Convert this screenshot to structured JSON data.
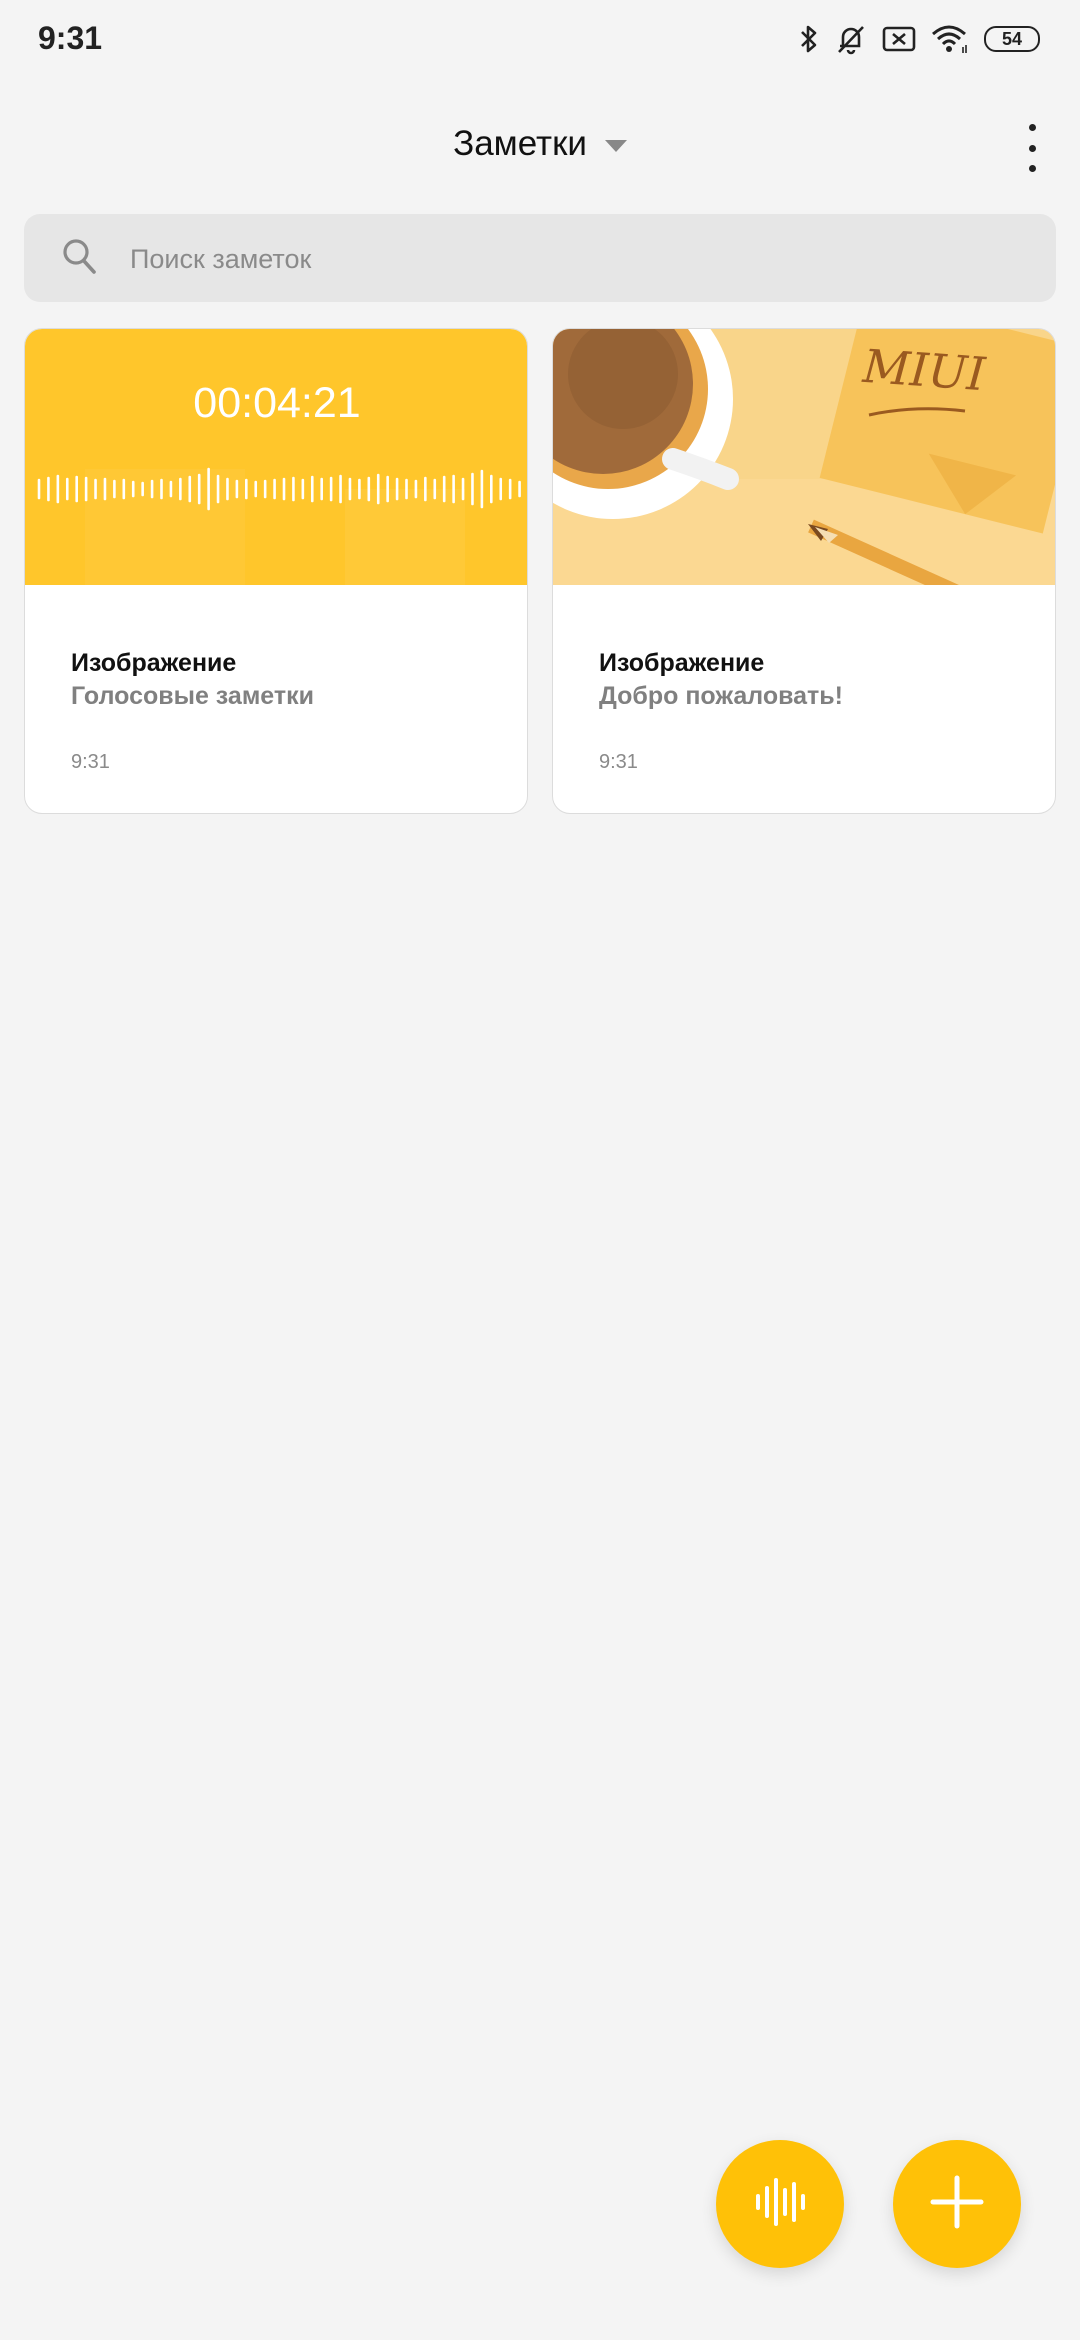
{
  "status_bar": {
    "time": "9:31",
    "battery": "54",
    "icons": [
      "bluetooth-icon",
      "muted-bell-icon",
      "no-sim-icon",
      "wifi-icon",
      "battery-icon"
    ]
  },
  "header": {
    "title": "Заметки",
    "dropdown_icon": "caret-down-icon",
    "more_icon": "more-vertical-icon"
  },
  "search": {
    "placeholder": "Поиск заметок",
    "value": "",
    "icon": "search-icon"
  },
  "notes": [
    {
      "thumbnail": "voice-waveform",
      "thumbnail_text": "00:04:21",
      "title": "Изображение",
      "subtitle": "Голосовые заметки",
      "time": "9:31"
    },
    {
      "thumbnail": "coffee-miui-illustration",
      "thumbnail_text": "MIUI",
      "title": "Изображение",
      "subtitle": "Добро пожаловать!",
      "time": "9:31"
    }
  ],
  "fabs": {
    "voice_icon": "voice-record-icon",
    "add_icon": "plus-icon"
  },
  "colors": {
    "background": "#f4f4f4",
    "accent": "#ffc107",
    "voice_thumb": "#ffc62b",
    "welcome_thumb": "#f9d58a",
    "search_bg": "#e6e6e6"
  }
}
